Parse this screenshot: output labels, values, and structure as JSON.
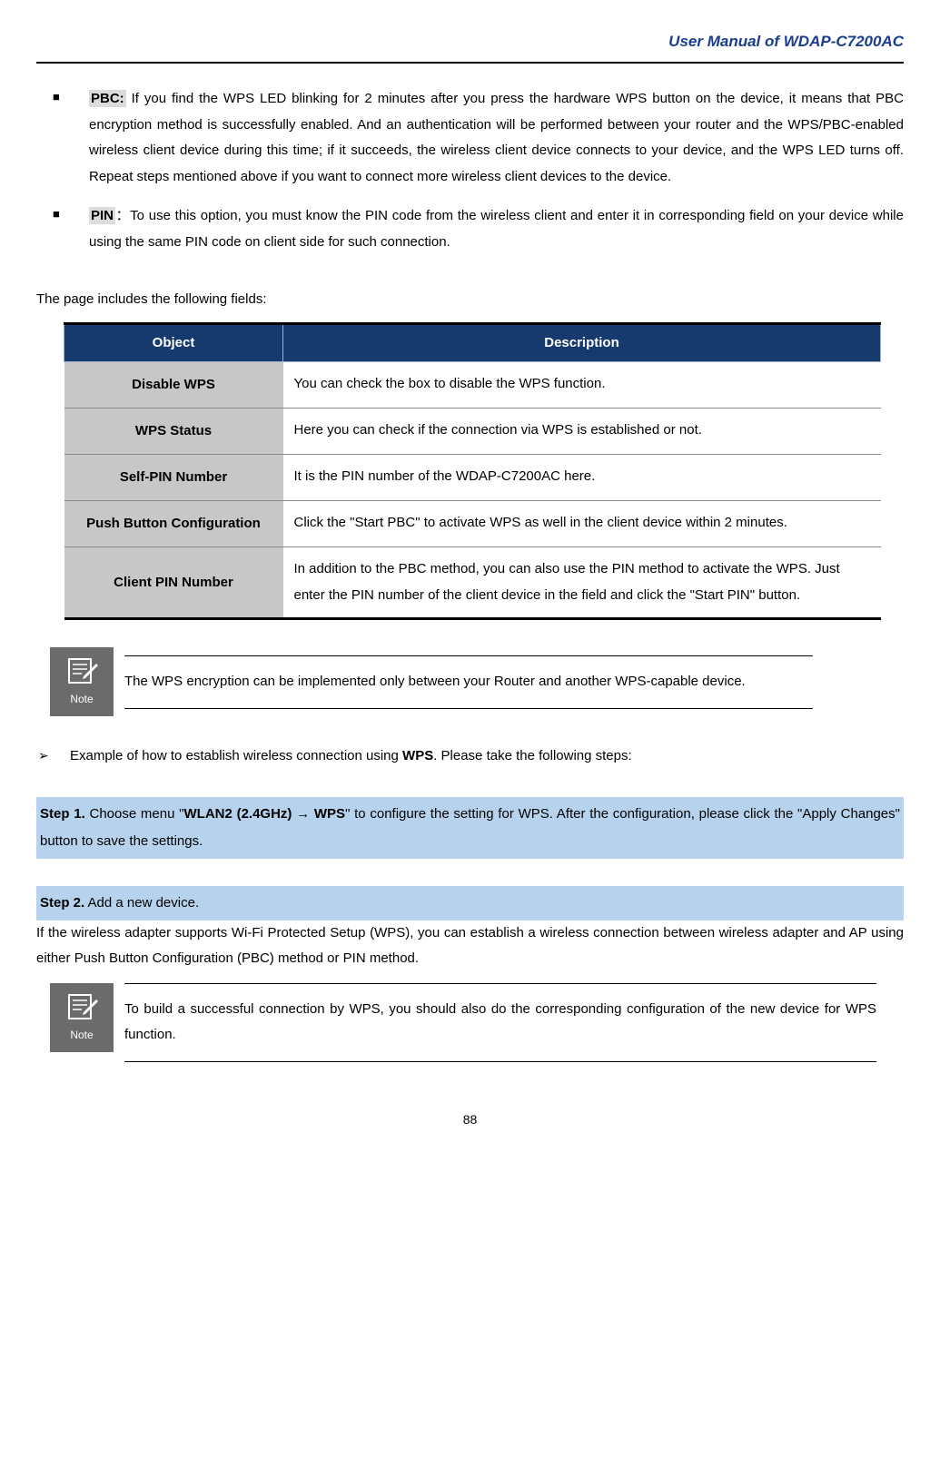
{
  "header": {
    "title": "User Manual of WDAP-C7200AC"
  },
  "bullets": {
    "pbc_label": "PBC:",
    "pbc_text": " If you find the WPS LED blinking for 2 minutes after you press the hardware WPS button on the device, it means that PBC encryption method is successfully enabled. And an authentication will be performed between your router and the WPS/PBC-enabled wireless client device during this time; if it succeeds, the wireless client device connects to your device, and the WPS LED turns off. Repeat steps mentioned above if you want to connect more wireless client devices to the device.",
    "pin_label": "PIN",
    "pin_sep": "：",
    "pin_text": "To use this option, you must know the PIN code from the wireless client and enter it in corresponding field on your device while using the same PIN code on client side for such connection."
  },
  "table_intro": "The page includes the following fields:",
  "table": {
    "headers": {
      "object": "Object",
      "description": "Description"
    },
    "rows": [
      {
        "obj": "Disable WPS",
        "desc": "You can check the box to disable the WPS function."
      },
      {
        "obj": "WPS Status",
        "desc": "Here you can check if the connection via WPS is established or not."
      },
      {
        "obj": "Self-PIN Number",
        "desc": "It is the PIN number of the WDAP-C7200AC here."
      },
      {
        "obj": "Push Button Configuration",
        "desc": "Click the \"Start PBC\" to activate WPS as well in the client device within 2 minutes."
      },
      {
        "obj": "Client PIN Number",
        "desc": "In addition to the PBC method, you can also use the PIN method to activate the WPS. Just enter the PIN number of the client device in the field and click the \"Start PIN\" button."
      }
    ]
  },
  "note1": {
    "label": "Note",
    "text": "The WPS encryption can be implemented only between your Router and another WPS-capable device."
  },
  "example": {
    "prefix": "Example of how to establish wireless connection using ",
    "bold": "WPS",
    "suffix": ". Please take the following steps:"
  },
  "step1": {
    "num": "Step 1.",
    "t1": "  Choose menu \"",
    "b1": "WLAN2 (2.4GHz) ",
    "arrow": "→",
    "b2": " WPS",
    "t2": "\" to configure the setting for WPS. After the configuration, please click the \"Apply Changes\" button to save the settings."
  },
  "step2": {
    "num": "Step 2.",
    "t1": "  Add a new device."
  },
  "step2_para": "If the wireless adapter supports Wi-Fi Protected Setup (WPS), you can establish a wireless connection between wireless adapter and AP using either Push Button Configuration (PBC) method or PIN method.",
  "note2": {
    "label": "Note",
    "text": "To build a successful connection by WPS, you should also do the corresponding configuration of the new device for WPS function."
  },
  "page_num": "88"
}
